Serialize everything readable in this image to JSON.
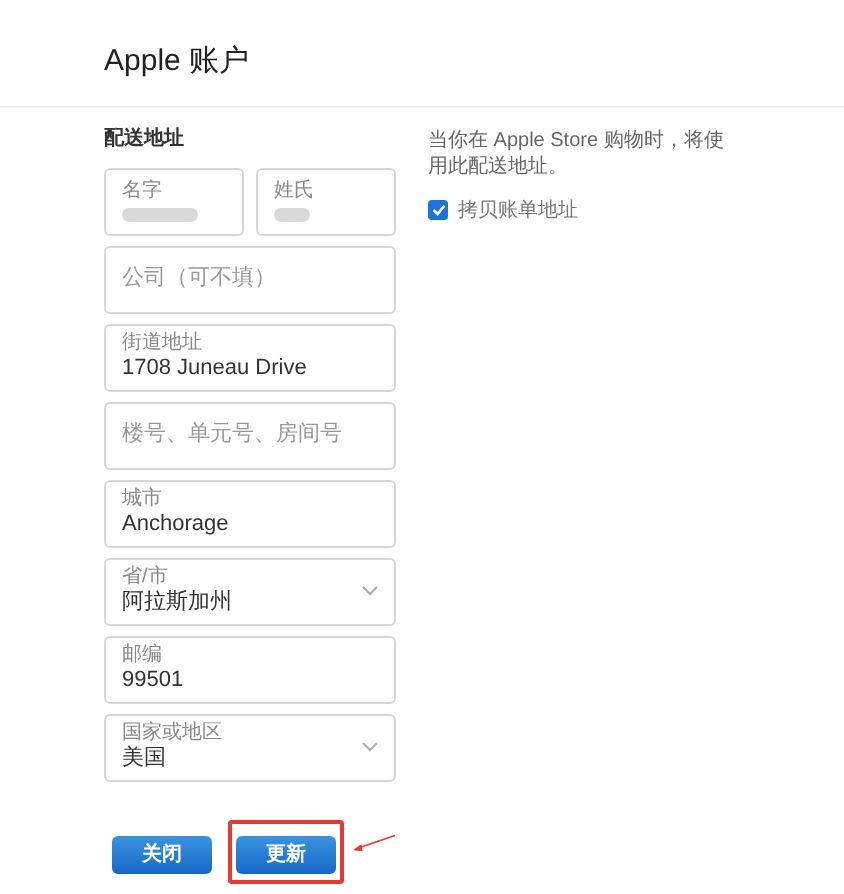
{
  "title": "Apple 账户",
  "section_label": "配送地址",
  "name_fields": [
    {
      "label": "名字"
    },
    {
      "label": "姓氏"
    }
  ],
  "fields": [
    {
      "kind": "text",
      "placeholder": "公司（可不填）"
    },
    {
      "kind": "text",
      "label": "街道地址",
      "value": "1708 Juneau Drive"
    },
    {
      "kind": "text",
      "placeholder": "楼号、单元号、房间号"
    },
    {
      "kind": "text",
      "label": "城市",
      "value": "Anchorage"
    },
    {
      "kind": "select",
      "label": "省/市",
      "value": "阿拉斯加州"
    },
    {
      "kind": "text",
      "label": "邮编",
      "value": "99501"
    },
    {
      "kind": "select",
      "label": "国家或地区",
      "value": "美国"
    }
  ],
  "note": "当你在 Apple Store 购物时，将使用此配送地址。",
  "copy_billing": {
    "label": "拷贝账单地址",
    "checked": true
  },
  "buttons": [
    {
      "label": "关闭",
      "annotated": false
    },
    {
      "label": "更新",
      "annotated": true
    }
  ]
}
